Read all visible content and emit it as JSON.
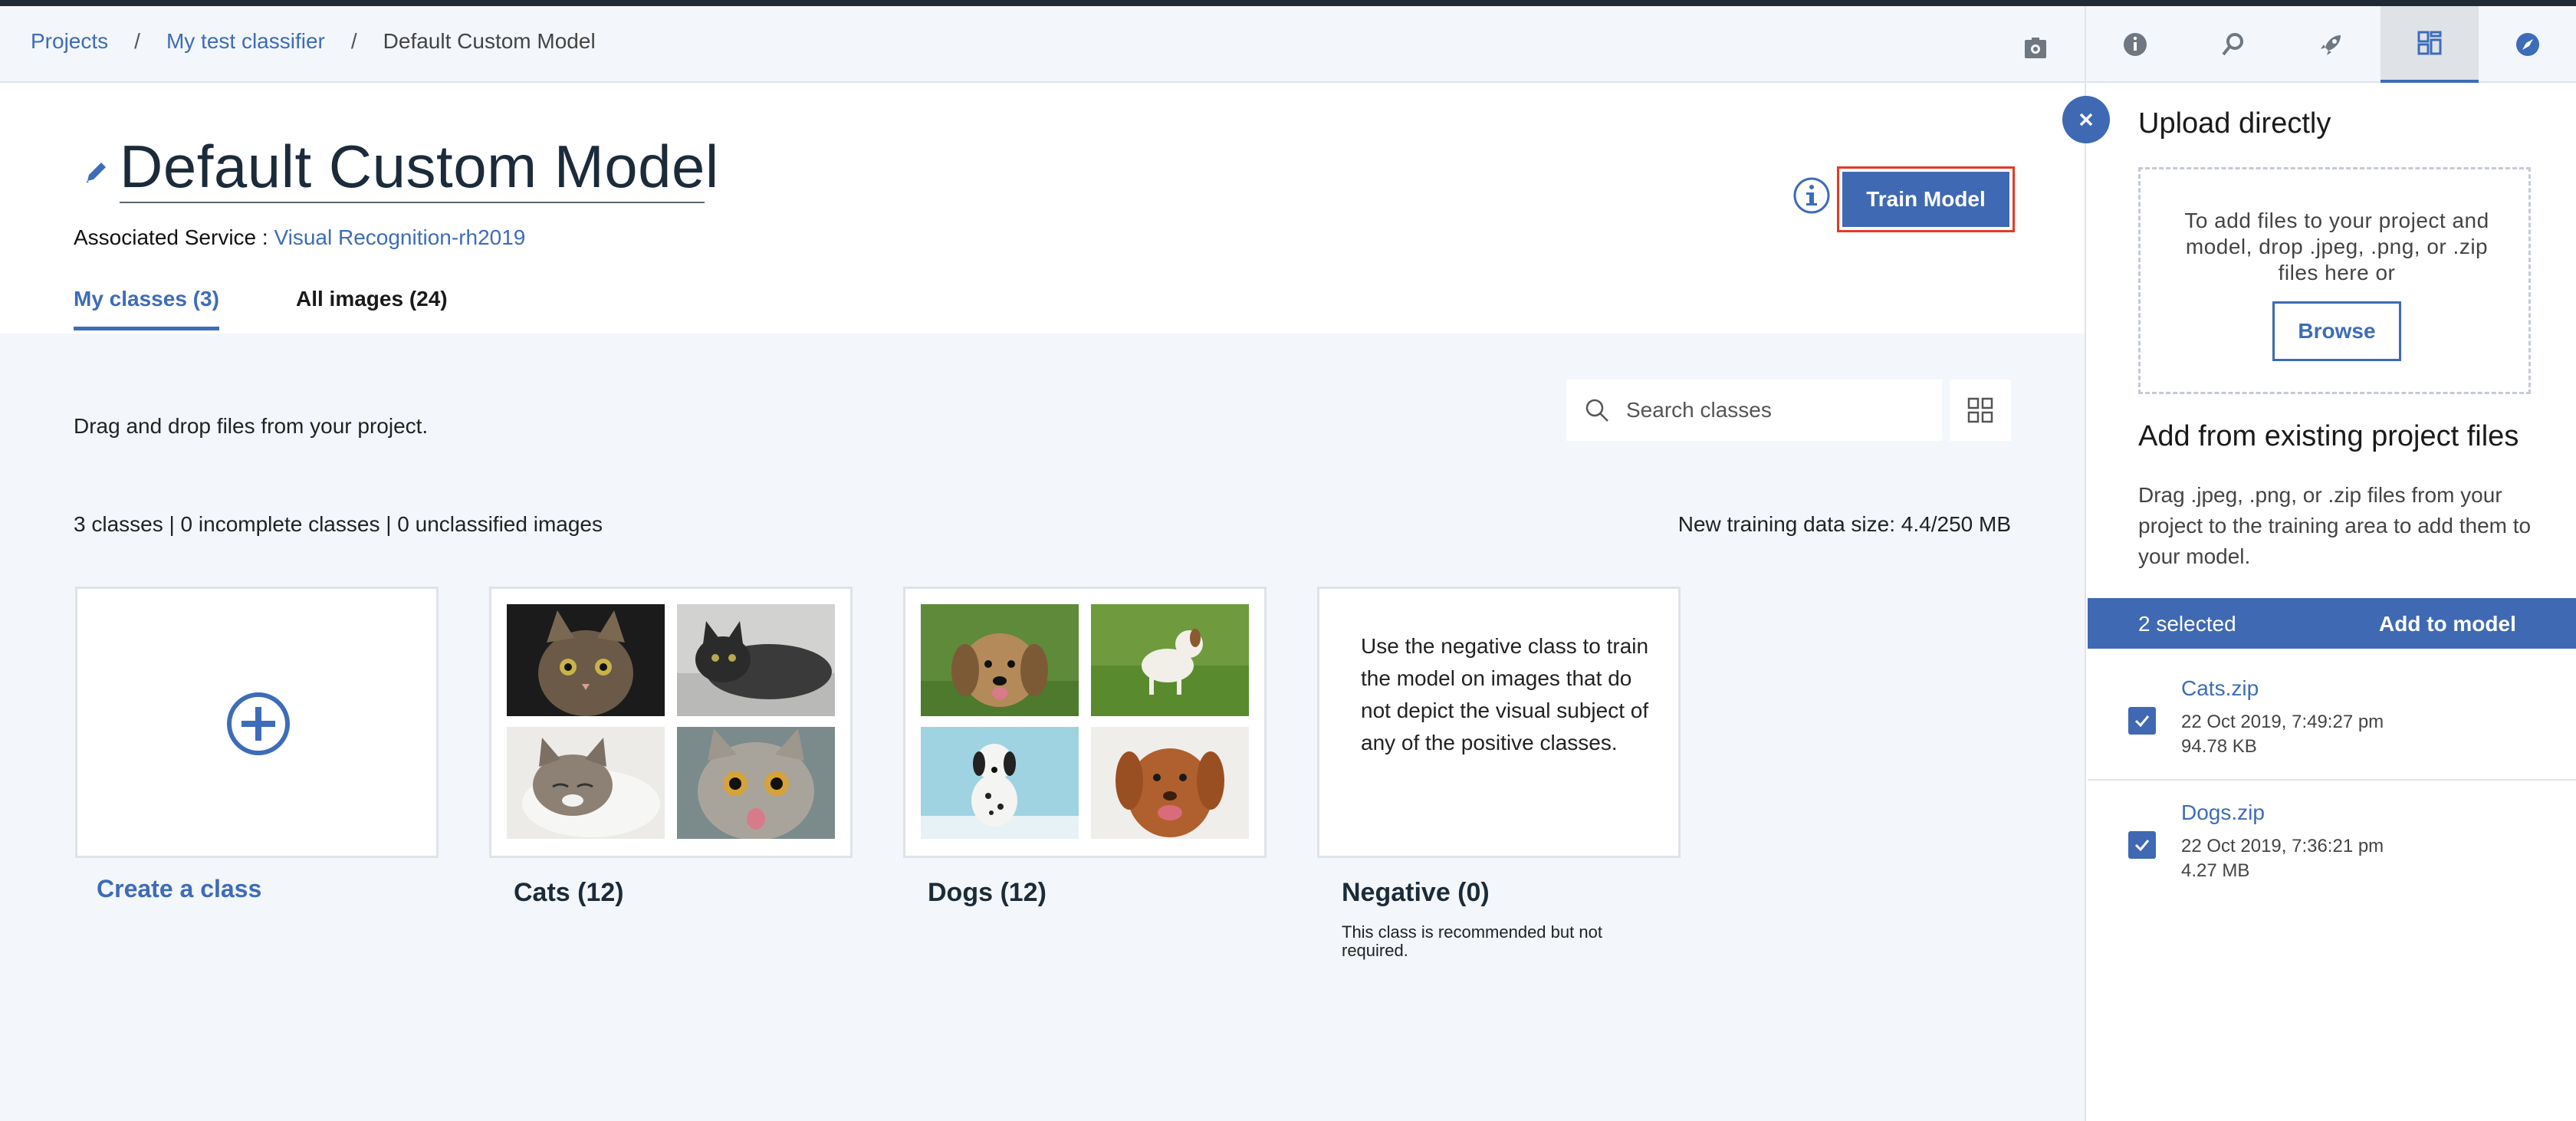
{
  "breadcrumb": {
    "items": [
      "Projects",
      "My test classifier"
    ],
    "current": "Default Custom Model",
    "separator": "/"
  },
  "model": {
    "title": "Default Custom Model",
    "associated_label": "Associated Service : ",
    "associated_service": "Visual Recognition-rh2019",
    "train_button": "Train Model"
  },
  "tabs": [
    {
      "label": "My classes (3)",
      "active": true
    },
    {
      "label": "All images (24)",
      "active": false
    }
  ],
  "content": {
    "drag_text": "Drag and drop files from your project.",
    "search_placeholder": "Search classes",
    "stats": "3 classes | 0 incomplete classes | 0 unclassified images",
    "training_size_label": "New training data size: ",
    "training_size_value": "4.4/250 MB"
  },
  "classes": {
    "create_label": "Create a class",
    "cats_label": "Cats (12)",
    "dogs_label": "Dogs (12)",
    "negative_label": "Negative (0)",
    "negative_description": "Use the negative class to train the model on images that do not depict the visual subject of any of the positive classes.",
    "negative_note": "This class is recommended but not required."
  },
  "panel": {
    "tabs": [
      "info-icon",
      "search-settings-icon",
      "rocket-icon",
      "data-grid-icon",
      "compass-icon"
    ],
    "active_tab": 3,
    "upload_title": "Upload directly",
    "drop_text": "To add files to your project and model, drop .jpeg, .png, or .zip files here or",
    "browse_label": "Browse",
    "existing_title": "Add from existing project files",
    "existing_desc": "Drag .jpeg, .png, or .zip files from your project to the training area to add them to your model.",
    "selected_count": "2 selected",
    "add_to_model": "Add to model",
    "files": [
      {
        "name": "Cats.zip",
        "date": "22 Oct 2019, 7:49:27 pm",
        "size": "94.78 KB",
        "checked": true
      },
      {
        "name": "Dogs.zip",
        "date": "22 Oct 2019, 7:36:21 pm",
        "size": "4.27 MB",
        "checked": true
      }
    ]
  },
  "colors": {
    "accent": "#3f69b2",
    "link": "#3d6cb8",
    "highlight_border": "#e43a25",
    "background": "#f3f6fa"
  }
}
